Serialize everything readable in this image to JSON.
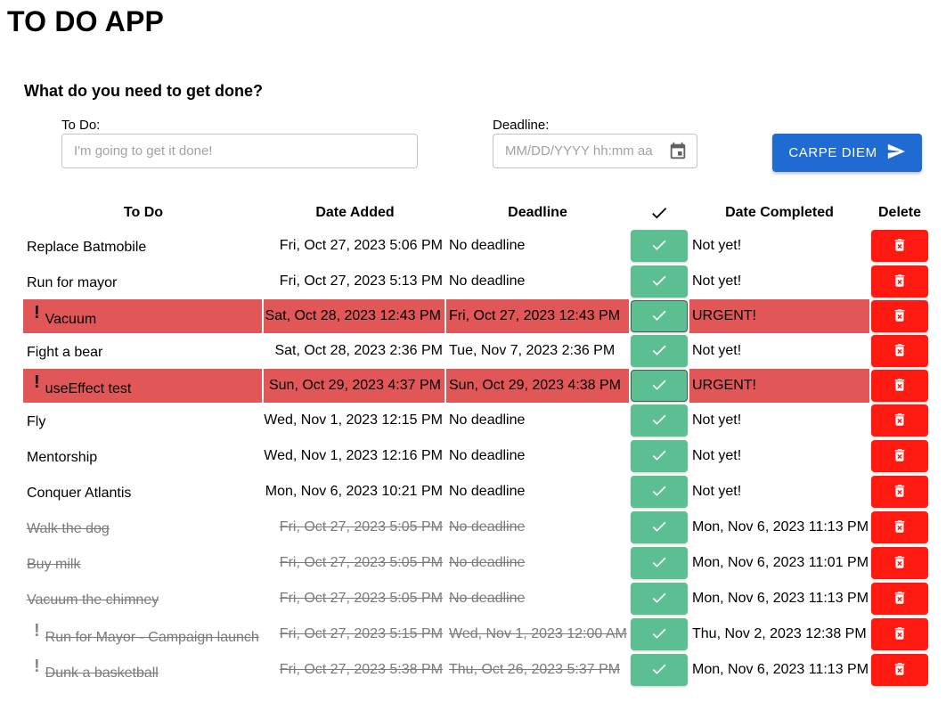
{
  "app": {
    "title": "TO DO APP"
  },
  "form": {
    "prompt": "What do you need to get done?",
    "todo_label": "To Do:",
    "todo_placeholder": "I'm going to get it done!",
    "deadline_label": "Deadline:",
    "deadline_placeholder": "MM/DD/YYYY hh:mm aa",
    "submit_label": "CARPE DIEM"
  },
  "table": {
    "headers": {
      "todo": "To Do",
      "date_added": "Date Added",
      "deadline": "Deadline",
      "completed_icon": "checkmark-icon",
      "date_completed": "Date Completed",
      "delete": "Delete"
    },
    "rows": [
      {
        "todo": "Replace Batmobile",
        "date_added": "Fri, Oct 27, 2023 5:06 PM",
        "deadline": "No deadline",
        "date_completed": "Not yet!",
        "urgent": false,
        "completed": false,
        "flag": false
      },
      {
        "todo": "Run for mayor",
        "date_added": "Fri, Oct 27, 2023 5:13 PM",
        "deadline": "No deadline",
        "date_completed": "Not yet!",
        "urgent": false,
        "completed": false,
        "flag": false
      },
      {
        "todo": "Vacuum",
        "date_added": "Sat, Oct 28, 2023 12:43 PM",
        "deadline": "Fri, Oct 27, 2023 12:43 PM",
        "date_completed": "URGENT!",
        "urgent": true,
        "completed": false,
        "flag": true
      },
      {
        "todo": "Fight a bear",
        "date_added": "Sat, Oct 28, 2023 2:36 PM",
        "deadline": "Tue, Nov 7, 2023 2:36 PM",
        "date_completed": "Not yet!",
        "urgent": false,
        "completed": false,
        "flag": false
      },
      {
        "todo": "useEffect test",
        "date_added": "Sun, Oct 29, 2023 4:37 PM",
        "deadline": "Sun, Oct 29, 2023 4:38 PM",
        "date_completed": "URGENT!",
        "urgent": true,
        "completed": false,
        "flag": true
      },
      {
        "todo": "Fly",
        "date_added": "Wed, Nov 1, 2023 12:15 PM",
        "deadline": "No deadline",
        "date_completed": "Not yet!",
        "urgent": false,
        "completed": false,
        "flag": false
      },
      {
        "todo": "Mentorship",
        "date_added": "Wed, Nov 1, 2023 12:16 PM",
        "deadline": "No deadline",
        "date_completed": "Not yet!",
        "urgent": false,
        "completed": false,
        "flag": false
      },
      {
        "todo": "Conquer Atlantis",
        "date_added": "Mon, Nov 6, 2023 10:21 PM",
        "deadline": "No deadline",
        "date_completed": "Not yet!",
        "urgent": false,
        "completed": false,
        "flag": false
      },
      {
        "todo": "Walk the dog",
        "date_added": "Fri, Oct 27, 2023 5:05 PM",
        "deadline": "No deadline",
        "date_completed": "Mon, Nov 6, 2023 11:13 PM",
        "urgent": false,
        "completed": true,
        "flag": false
      },
      {
        "todo": "Buy milk",
        "date_added": "Fri, Oct 27, 2023 5:05 PM",
        "deadline": "No deadline",
        "date_completed": "Mon, Nov 6, 2023 11:01 PM",
        "urgent": false,
        "completed": true,
        "flag": false
      },
      {
        "todo": "Vacuum the chimney",
        "date_added": "Fri, Oct 27, 2023 5:05 PM",
        "deadline": "No deadline",
        "date_completed": "Mon, Nov 6, 2023 11:13 PM",
        "urgent": false,
        "completed": true,
        "flag": false
      },
      {
        "todo": "Run for Mayor - Campaign launch",
        "date_added": "Fri, Oct 27, 2023 5:15 PM",
        "deadline": "Wed, Nov 1, 2023 12:00 AM",
        "date_completed": "Thu, Nov 2, 2023 12:38 PM",
        "urgent": false,
        "completed": true,
        "flag": true
      },
      {
        "todo": "Dunk a basketball",
        "date_added": "Fri, Oct 27, 2023 5:38 PM",
        "deadline": "Thu, Oct 26, 2023 5:37 PM",
        "date_completed": "Mon, Nov 6, 2023 11:13 PM",
        "urgent": false,
        "completed": true,
        "flag": true
      }
    ]
  },
  "colors": {
    "primary_button": "#1f6bd1",
    "complete_button": "#5cbf92",
    "delete_button": "#fe1a10",
    "urgent_row": "#e15656"
  }
}
